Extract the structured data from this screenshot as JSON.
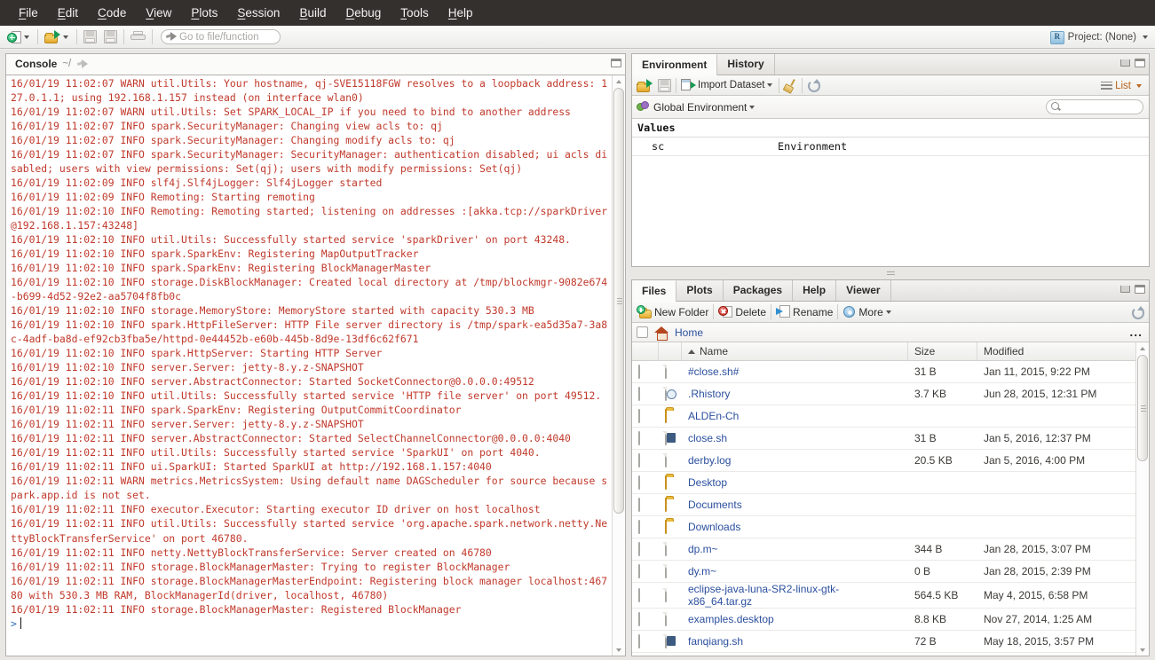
{
  "menu": {
    "items": [
      {
        "label": "File",
        "accel": "F"
      },
      {
        "label": "Edit",
        "accel": "E"
      },
      {
        "label": "Code",
        "accel": "C"
      },
      {
        "label": "View",
        "accel": "V"
      },
      {
        "label": "Plots",
        "accel": "P"
      },
      {
        "label": "Session",
        "accel": "S"
      },
      {
        "label": "Build",
        "accel": "B"
      },
      {
        "label": "Debug",
        "accel": "D"
      },
      {
        "label": "Tools",
        "accel": "T"
      },
      {
        "label": "Help",
        "accel": "H"
      }
    ]
  },
  "toolbar": {
    "new_file_icon": "new-document-icon",
    "open_file_icon": "open-folder-icon",
    "save_icon": "save-icon",
    "save_all_icon": "save-all-icon",
    "print_icon": "print-icon",
    "goto_placeholder": "Go to file/function",
    "goto_value": "",
    "project_label": "Project: (None)",
    "project_icon": "r-project-icon"
  },
  "console": {
    "tab_label": "Console",
    "working_dir": "~/",
    "lines": [
      "16/01/19 11:02:07 WARN util.Utils: Your hostname, qj-SVE15118FGW resolves to a loopback address: 127.0.1.1; using 192.168.1.157 instead (on interface wlan0)",
      "16/01/19 11:02:07 WARN util.Utils: Set SPARK_LOCAL_IP if you need to bind to another address",
      "16/01/19 11:02:07 INFO spark.SecurityManager: Changing view acls to: qj",
      "16/01/19 11:02:07 INFO spark.SecurityManager: Changing modify acls to: qj",
      "16/01/19 11:02:07 INFO spark.SecurityManager: SecurityManager: authentication disabled; ui acls disabled; users with view permissions: Set(qj); users with modify permissions: Set(qj)",
      "16/01/19 11:02:09 INFO slf4j.Slf4jLogger: Slf4jLogger started",
      "16/01/19 11:02:09 INFO Remoting: Starting remoting",
      "16/01/19 11:02:10 INFO Remoting: Remoting started; listening on addresses :[akka.tcp://sparkDriver@192.168.1.157:43248]",
      "16/01/19 11:02:10 INFO util.Utils: Successfully started service 'sparkDriver' on port 43248.",
      "16/01/19 11:02:10 INFO spark.SparkEnv: Registering MapOutputTracker",
      "16/01/19 11:02:10 INFO spark.SparkEnv: Registering BlockManagerMaster",
      "16/01/19 11:02:10 INFO storage.DiskBlockManager: Created local directory at /tmp/blockmgr-9082e674-b699-4d52-92e2-aa5704f8fb0c",
      "16/01/19 11:02:10 INFO storage.MemoryStore: MemoryStore started with capacity 530.3 MB",
      "16/01/19 11:02:10 INFO spark.HttpFileServer: HTTP File server directory is /tmp/spark-ea5d35a7-3a8c-4adf-ba8d-ef92cb3fba5e/httpd-0e44452b-e60b-445b-8d9e-13df6c62f671",
      "16/01/19 11:02:10 INFO spark.HttpServer: Starting HTTP Server",
      "16/01/19 11:02:10 INFO server.Server: jetty-8.y.z-SNAPSHOT",
      "16/01/19 11:02:10 INFO server.AbstractConnector: Started SocketConnector@0.0.0.0:49512",
      "16/01/19 11:02:10 INFO util.Utils: Successfully started service 'HTTP file server' on port 49512.",
      "16/01/19 11:02:11 INFO spark.SparkEnv: Registering OutputCommitCoordinator",
      "16/01/19 11:02:11 INFO server.Server: jetty-8.y.z-SNAPSHOT",
      "16/01/19 11:02:11 INFO server.AbstractConnector: Started SelectChannelConnector@0.0.0.0:4040",
      "16/01/19 11:02:11 INFO util.Utils: Successfully started service 'SparkUI' on port 4040.",
      "16/01/19 11:02:11 INFO ui.SparkUI: Started SparkUI at http://192.168.1.157:4040",
      "16/01/19 11:02:11 WARN metrics.MetricsSystem: Using default name DAGScheduler for source because spark.app.id is not set.",
      "16/01/19 11:02:11 INFO executor.Executor: Starting executor ID driver on host localhost",
      "16/01/19 11:02:11 INFO util.Utils: Successfully started service 'org.apache.spark.network.netty.NettyBlockTransferService' on port 46780.",
      "16/01/19 11:02:11 INFO netty.NettyBlockTransferService: Server created on 46780",
      "16/01/19 11:02:11 INFO storage.BlockManagerMaster: Trying to register BlockManager",
      "16/01/19 11:02:11 INFO storage.BlockManagerMasterEndpoint: Registering block manager localhost:46780 with 530.3 MB RAM, BlockManagerId(driver, localhost, 46780)",
      "16/01/19 11:02:11 INFO storage.BlockManagerMaster: Registered BlockManager"
    ],
    "prompt": ">"
  },
  "environment": {
    "tabs": [
      {
        "label": "Environment",
        "active": true
      },
      {
        "label": "History",
        "active": false
      }
    ],
    "toolbar": {
      "load_icon": "open-workspace-icon",
      "save_icon": "save-workspace-icon",
      "import_label": "Import Dataset",
      "import_icon": "import-dataset-icon",
      "clear_icon": "broom-clear-icon",
      "refresh_icon": "refresh-icon",
      "view_mode_label": "List",
      "view_mode_icon": "list-lines-icon"
    },
    "scope_label": "Global Environment",
    "scope_icon": "environment-globe-icon",
    "search_placeholder": "",
    "search_value": "",
    "groups": [
      {
        "label": "Values",
        "rows": [
          {
            "name": "sc",
            "value": "Environment"
          }
        ]
      }
    ]
  },
  "files": {
    "tabs": [
      {
        "label": "Files",
        "active": true
      },
      {
        "label": "Plots",
        "active": false
      },
      {
        "label": "Packages",
        "active": false
      },
      {
        "label": "Help",
        "active": false
      },
      {
        "label": "Viewer",
        "active": false
      }
    ],
    "toolbar": {
      "new_folder_label": "New Folder",
      "new_folder_icon": "new-folder-icon",
      "delete_label": "Delete",
      "delete_icon": "delete-icon",
      "rename_label": "Rename",
      "rename_icon": "rename-icon",
      "more_label": "More",
      "more_icon": "gear-icon",
      "refresh_icon": "refresh-icon"
    },
    "breadcrumb": "Home",
    "breadcrumb_icon": "home-icon",
    "overflow_label": "...",
    "columns": {
      "name": "Name",
      "size": "Size",
      "modified": "Modified"
    },
    "sort_column": "Name",
    "rows": [
      {
        "icon": "doc",
        "name": "#close.sh#",
        "size": "31 B",
        "modified": "Jan 11, 2015, 9:22 PM"
      },
      {
        "icon": "hist",
        "name": ".Rhistory",
        "size": "3.7 KB",
        "modified": "Jun 28, 2015, 12:31 PM"
      },
      {
        "icon": "folder",
        "name": "ALDEn-Ch",
        "size": "",
        "modified": ""
      },
      {
        "icon": "sh",
        "name": "close.sh",
        "size": "31 B",
        "modified": "Jan 5, 2016, 12:37 PM"
      },
      {
        "icon": "doc",
        "name": "derby.log",
        "size": "20.5 KB",
        "modified": "Jan 5, 2016, 4:00 PM"
      },
      {
        "icon": "folder",
        "name": "Desktop",
        "size": "",
        "modified": ""
      },
      {
        "icon": "folder",
        "name": "Documents",
        "size": "",
        "modified": ""
      },
      {
        "icon": "folder",
        "name": "Downloads",
        "size": "",
        "modified": ""
      },
      {
        "icon": "doc",
        "name": "dp.m~",
        "size": "344 B",
        "modified": "Jan 28, 2015, 3:07 PM"
      },
      {
        "icon": "doc",
        "name": "dy.m~",
        "size": "0 B",
        "modified": "Jan 28, 2015, 2:39 PM"
      },
      {
        "icon": "doc",
        "name": "eclipse-java-luna-SR2-linux-gtk-x86_64.tar.gz",
        "size": "564.5 KB",
        "modified": "May 4, 2015, 6:58 PM"
      },
      {
        "icon": "doc",
        "name": "examples.desktop",
        "size": "8.8 KB",
        "modified": "Nov 27, 2014, 1:25 AM"
      },
      {
        "icon": "sh",
        "name": "fanqiang.sh",
        "size": "72 B",
        "modified": "May 18, 2015, 3:57 PM"
      }
    ]
  },
  "colors": {
    "menubar_bg": "#33302e",
    "console_text": "#c0392b",
    "prompt": "#2b6cb0",
    "link": "#2b4f9e",
    "accent_orange": "#b9651c"
  }
}
